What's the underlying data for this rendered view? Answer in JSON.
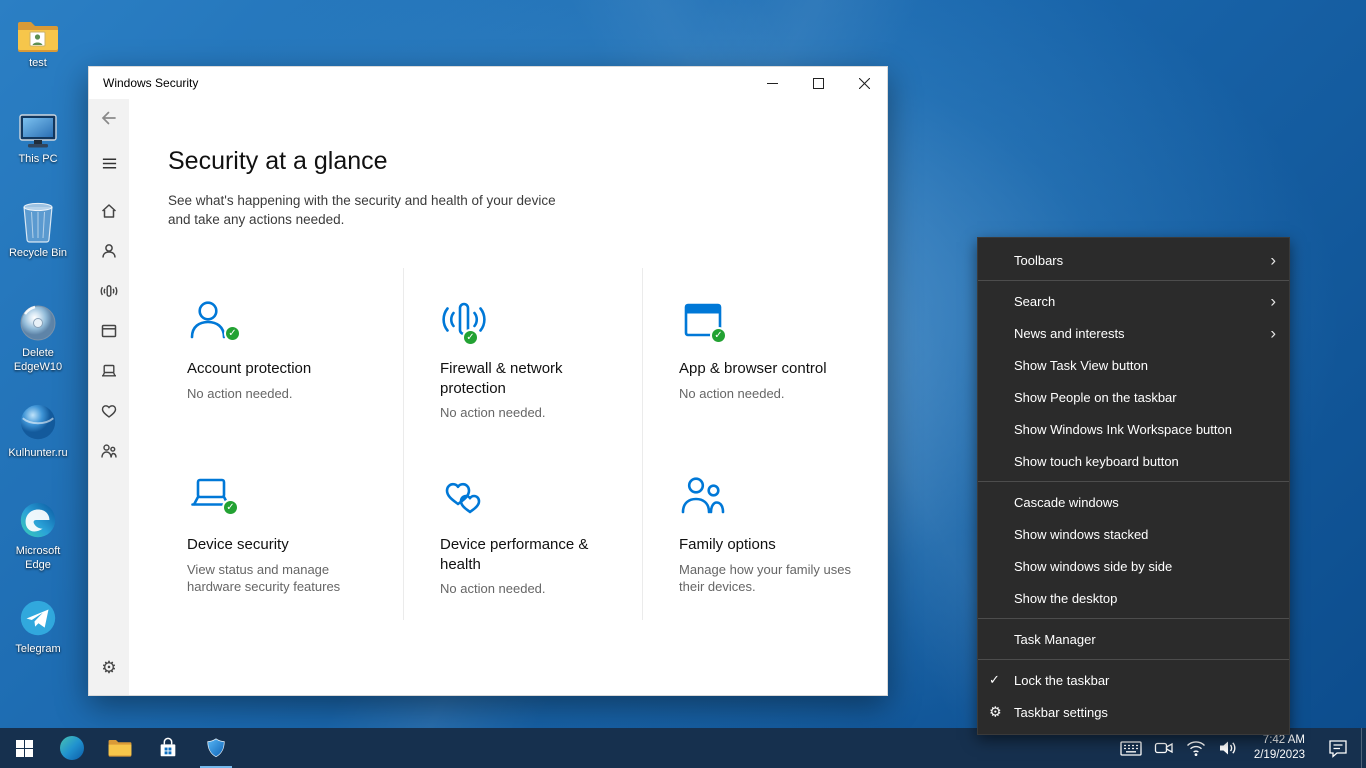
{
  "desktop": {
    "icons": [
      {
        "label": "test"
      },
      {
        "label": "This PC"
      },
      {
        "label": "Recycle Bin"
      },
      {
        "label": "Delete EdgeW10"
      },
      {
        "label": "Kulhunter.ru"
      },
      {
        "label": "Microsoft Edge"
      },
      {
        "label": "Telegram"
      }
    ]
  },
  "window": {
    "title": "Windows Security",
    "heading": "Security at a glance",
    "subtitle": "See what's happening with the security and health of your device and take any actions needed.",
    "tiles": [
      {
        "title": "Account protection",
        "desc": "No action needed."
      },
      {
        "title": "Firewall & network protection",
        "desc": "No action needed."
      },
      {
        "title": "App & browser control",
        "desc": "No action needed."
      },
      {
        "title": "Device security",
        "desc": "View status and manage hardware security features"
      },
      {
        "title": "Device performance & health",
        "desc": "No action needed."
      },
      {
        "title": "Family options",
        "desc": "Manage how your family uses their devices."
      }
    ]
  },
  "context_menu": {
    "groups": [
      {
        "items": [
          {
            "label": "Toolbars"
          }
        ]
      },
      {
        "items": [
          {
            "label": "Search"
          },
          {
            "label": "News and interests"
          },
          {
            "label": "Show Task View button"
          },
          {
            "label": "Show People on the taskbar"
          },
          {
            "label": "Show Windows Ink Workspace button"
          },
          {
            "label": "Show touch keyboard button"
          }
        ]
      },
      {
        "items": [
          {
            "label": "Cascade windows"
          },
          {
            "label": "Show windows stacked"
          },
          {
            "label": "Show windows side by side"
          },
          {
            "label": "Show the desktop"
          }
        ]
      },
      {
        "items": [
          {
            "label": "Task Manager"
          }
        ]
      },
      {
        "items": [
          {
            "label": "Lock the taskbar",
            "checked": true
          },
          {
            "label": "Taskbar settings",
            "icon": "gear"
          }
        ]
      }
    ]
  },
  "taskbar": {
    "clock": {
      "time": "7:42 AM",
      "date": "2/19/2023"
    }
  },
  "colors": {
    "accent": "#0078d7",
    "success_green": "#23a233",
    "taskbar_bg": "#16304e",
    "menu_bg": "#2b2b2b"
  }
}
